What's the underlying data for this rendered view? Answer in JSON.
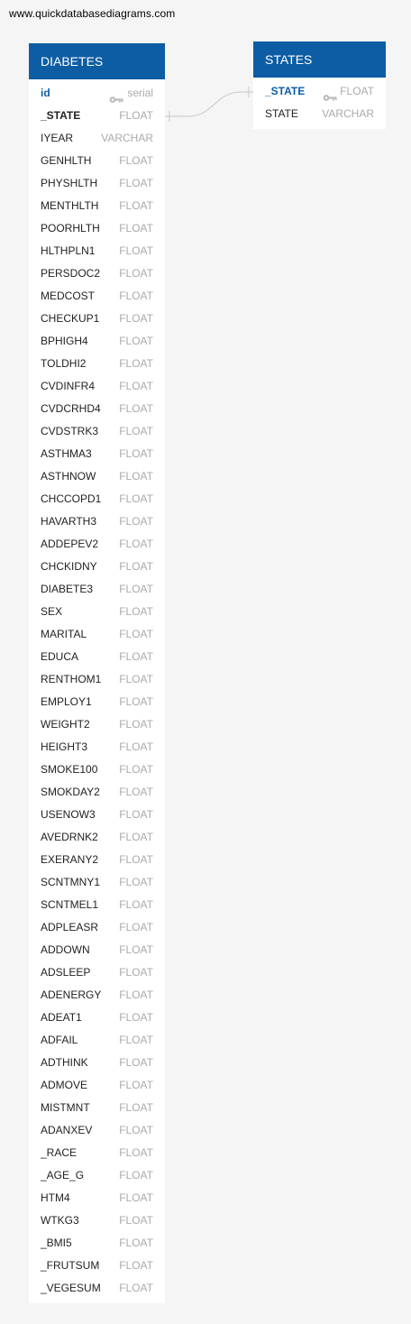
{
  "site": {
    "url": "www.quickdatabasediagrams.com"
  },
  "colors": {
    "header": "#0d5da4",
    "primary_key_text": "#0d5da4",
    "type_text": "#aaaaaa",
    "background": "#f4f5f4",
    "connector": "#c8c8c8"
  },
  "relationship": {
    "from": "DIABETES._STATE",
    "to": "STATES._STATE"
  },
  "tables": {
    "diabetes": {
      "name": "DIABETES",
      "fields": [
        {
          "name": "id",
          "type": "serial",
          "pk": true
        },
        {
          "name": "_STATE",
          "type": "FLOAT",
          "fk": true
        },
        {
          "name": "IYEAR",
          "type": "VARCHAR"
        },
        {
          "name": "GENHLTH",
          "type": "FLOAT"
        },
        {
          "name": "PHYSHLTH",
          "type": "FLOAT"
        },
        {
          "name": "MENTHLTH",
          "type": "FLOAT"
        },
        {
          "name": "POORHLTH",
          "type": "FLOAT"
        },
        {
          "name": "HLTHPLN1",
          "type": "FLOAT"
        },
        {
          "name": "PERSDOC2",
          "type": "FLOAT"
        },
        {
          "name": "MEDCOST",
          "type": "FLOAT"
        },
        {
          "name": "CHECKUP1",
          "type": "FLOAT"
        },
        {
          "name": "BPHIGH4",
          "type": "FLOAT"
        },
        {
          "name": "TOLDHI2",
          "type": "FLOAT"
        },
        {
          "name": "CVDINFR4",
          "type": "FLOAT"
        },
        {
          "name": "CVDCRHD4",
          "type": "FLOAT"
        },
        {
          "name": "CVDSTRK3",
          "type": "FLOAT"
        },
        {
          "name": "ASTHMA3",
          "type": "FLOAT"
        },
        {
          "name": "ASTHNOW",
          "type": "FLOAT"
        },
        {
          "name": "CHCCOPD1",
          "type": "FLOAT"
        },
        {
          "name": "HAVARTH3",
          "type": "FLOAT"
        },
        {
          "name": "ADDEPEV2",
          "type": "FLOAT"
        },
        {
          "name": "CHCKIDNY",
          "type": "FLOAT"
        },
        {
          "name": "DIABETE3",
          "type": "FLOAT"
        },
        {
          "name": "SEX",
          "type": "FLOAT"
        },
        {
          "name": "MARITAL",
          "type": "FLOAT"
        },
        {
          "name": "EDUCA",
          "type": "FLOAT"
        },
        {
          "name": "RENTHOM1",
          "type": "FLOAT"
        },
        {
          "name": "EMPLOY1",
          "type": "FLOAT"
        },
        {
          "name": "WEIGHT2",
          "type": "FLOAT"
        },
        {
          "name": "HEIGHT3",
          "type": "FLOAT"
        },
        {
          "name": "SMOKE100",
          "type": "FLOAT"
        },
        {
          "name": "SMOKDAY2",
          "type": "FLOAT"
        },
        {
          "name": "USENOW3",
          "type": "FLOAT"
        },
        {
          "name": "AVEDRNK2",
          "type": "FLOAT"
        },
        {
          "name": "EXERANY2",
          "type": "FLOAT"
        },
        {
          "name": "SCNTMNY1",
          "type": "FLOAT"
        },
        {
          "name": "SCNTMEL1",
          "type": "FLOAT"
        },
        {
          "name": "ADPLEASR",
          "type": "FLOAT"
        },
        {
          "name": "ADDOWN",
          "type": "FLOAT"
        },
        {
          "name": "ADSLEEP",
          "type": "FLOAT"
        },
        {
          "name": "ADENERGY",
          "type": "FLOAT"
        },
        {
          "name": "ADEAT1",
          "type": "FLOAT"
        },
        {
          "name": "ADFAIL",
          "type": "FLOAT"
        },
        {
          "name": "ADTHINK",
          "type": "FLOAT"
        },
        {
          "name": "ADMOVE",
          "type": "FLOAT"
        },
        {
          "name": "MISTMNT",
          "type": "FLOAT"
        },
        {
          "name": "ADANXEV",
          "type": "FLOAT"
        },
        {
          "name": "_RACE",
          "type": "FLOAT"
        },
        {
          "name": "_AGE_G",
          "type": "FLOAT"
        },
        {
          "name": "HTM4",
          "type": "FLOAT"
        },
        {
          "name": "WTKG3",
          "type": "FLOAT"
        },
        {
          "name": "_BMI5",
          "type": "FLOAT"
        },
        {
          "name": "_FRUTSUM",
          "type": "FLOAT"
        },
        {
          "name": "_VEGESUM",
          "type": "FLOAT"
        }
      ]
    },
    "states": {
      "name": "STATES",
      "fields": [
        {
          "name": "_STATE",
          "type": "FLOAT",
          "pk": true
        },
        {
          "name": "STATE",
          "type": "VARCHAR"
        }
      ]
    }
  }
}
